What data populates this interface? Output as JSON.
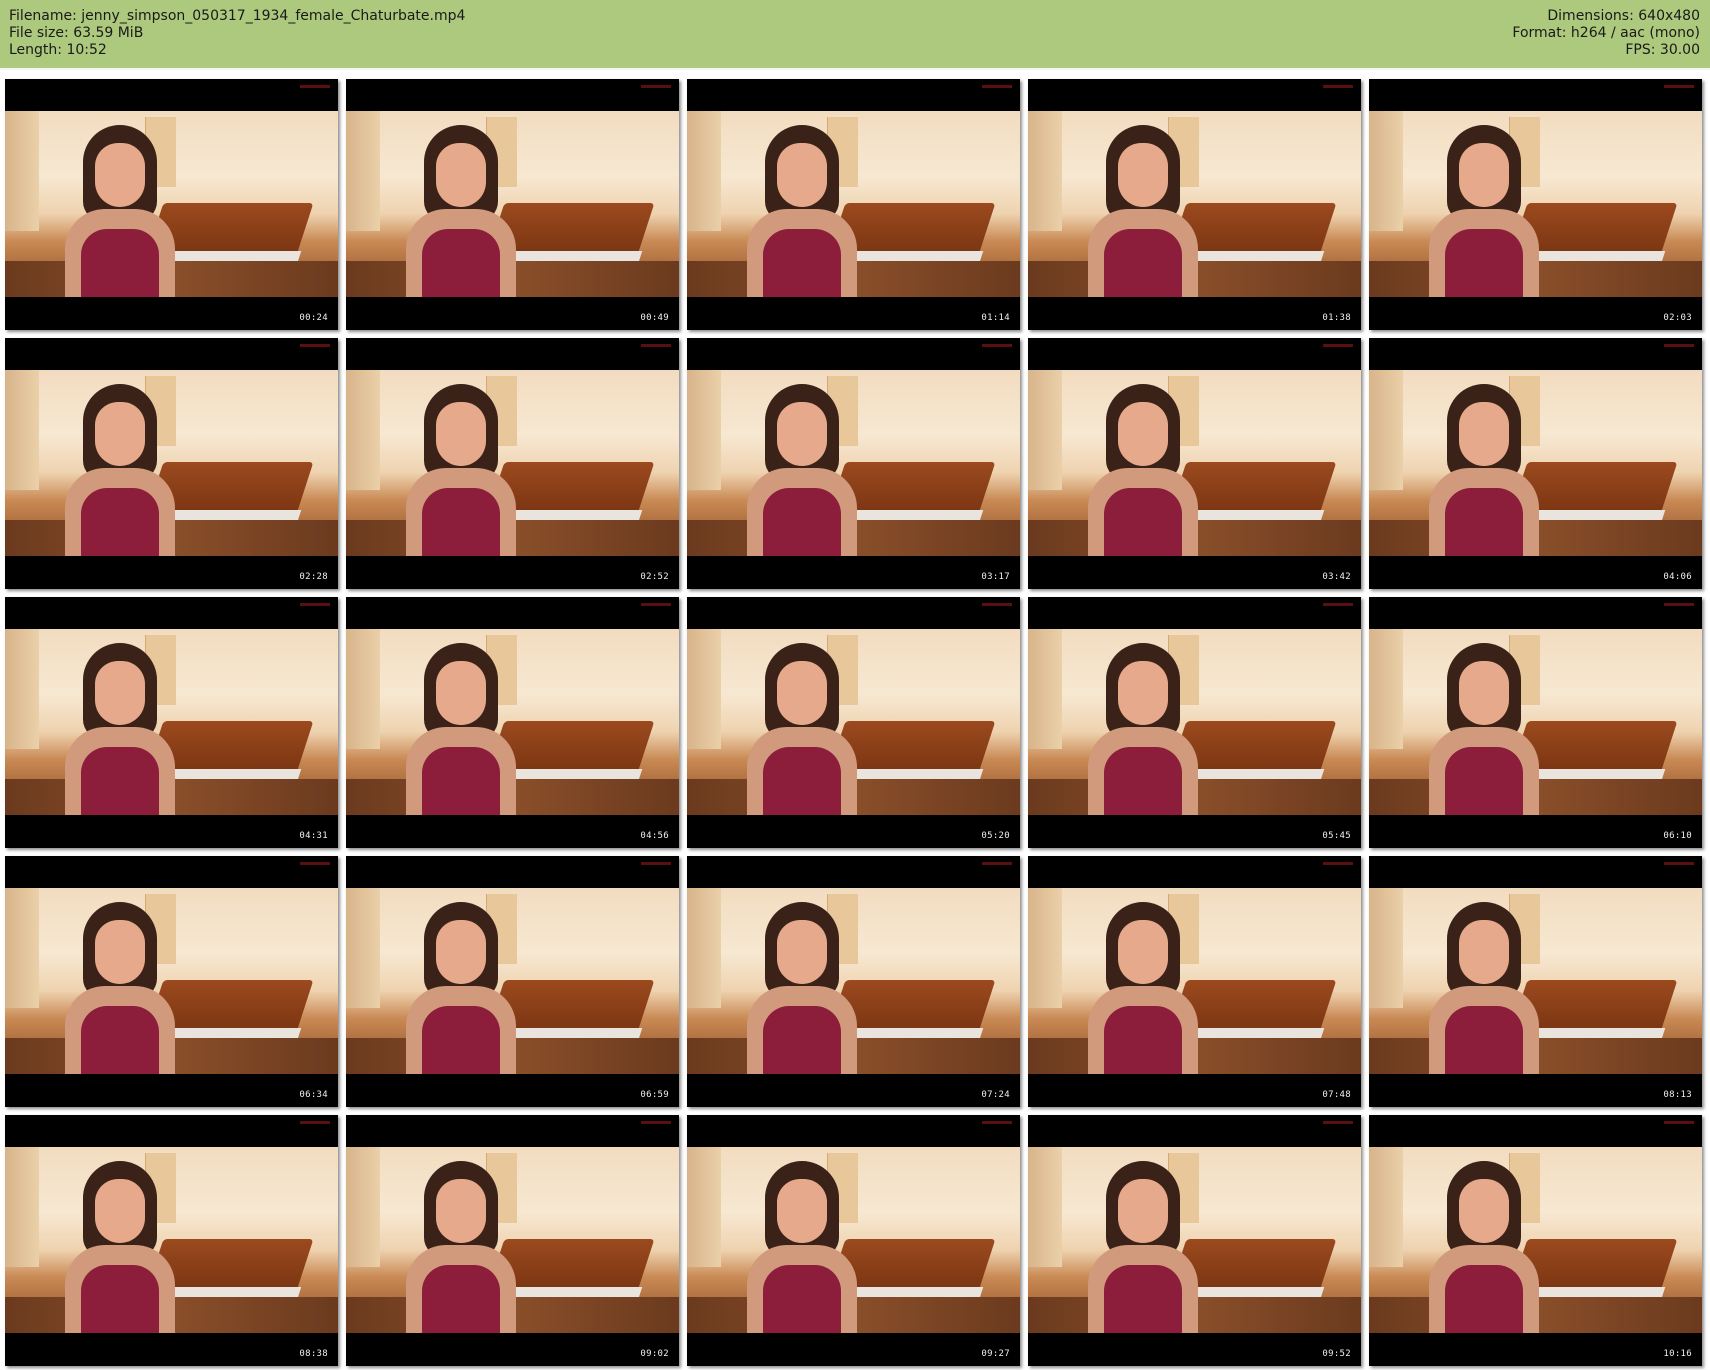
{
  "header": {
    "filename": "Filename: jenny_simpson_050317_1934_female_Chaturbate.mp4",
    "filesize": "File size: 63.59 MiB",
    "length": "Length: 10:52",
    "dimensions": "Dimensions: 640x480",
    "format": "Format: h264 / aac (mono)",
    "fps": "FPS: 30.00"
  },
  "colors": {
    "header_bg": "#acc97d",
    "frame_black": "#000000",
    "timestamp": "#f0f0f0"
  },
  "thumbnails": [
    {
      "time": "00:24"
    },
    {
      "time": "00:49"
    },
    {
      "time": "01:14"
    },
    {
      "time": "01:38"
    },
    {
      "time": "02:03"
    },
    {
      "time": "02:28"
    },
    {
      "time": "02:52"
    },
    {
      "time": "03:17"
    },
    {
      "time": "03:42"
    },
    {
      "time": "04:06"
    },
    {
      "time": "04:31"
    },
    {
      "time": "04:56"
    },
    {
      "time": "05:20"
    },
    {
      "time": "05:45"
    },
    {
      "time": "06:10"
    },
    {
      "time": "06:34"
    },
    {
      "time": "06:59"
    },
    {
      "time": "07:24"
    },
    {
      "time": "07:48"
    },
    {
      "time": "08:13"
    },
    {
      "time": "08:38"
    },
    {
      "time": "09:02"
    },
    {
      "time": "09:27"
    },
    {
      "time": "09:52"
    },
    {
      "time": "10:16"
    }
  ]
}
